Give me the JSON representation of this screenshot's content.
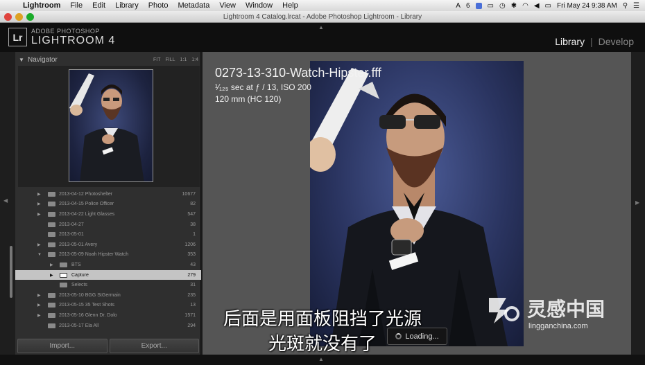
{
  "menubar": {
    "items": [
      "Lightroom",
      "File",
      "Edit",
      "Library",
      "Photo",
      "Metadata",
      "View",
      "Window",
      "Help"
    ],
    "status": {
      "badge": "6",
      "clock": "Fri May 24  9:38 AM"
    }
  },
  "window": {
    "title": "Lightroom 4 Catalog.lrcat - Adobe Photoshop Lightroom - Library"
  },
  "identity": {
    "badge": "Lr",
    "brand_small": "ADOBE PHOTOSHOP",
    "brand_big": "LIGHTROOM 4"
  },
  "modules": {
    "active": "Library",
    "separator": "|",
    "inactive": "Develop"
  },
  "navigator": {
    "title": "Navigator",
    "zoom_options": [
      "FIT",
      "FILL",
      "1:1",
      "1:4"
    ]
  },
  "folders": [
    {
      "name": "2013-04-12 Photoshelter",
      "count": "10677",
      "expand": "right",
      "indent": 0
    },
    {
      "name": "2013-04-15 Police Officer",
      "count": "82",
      "expand": "right",
      "indent": 0
    },
    {
      "name": "2013-04-22 Light Glasses",
      "count": "547",
      "expand": "right",
      "indent": 0
    },
    {
      "name": "2013-04-27",
      "count": "38",
      "expand": "",
      "indent": 0
    },
    {
      "name": "2013-05-01",
      "count": "1",
      "expand": "",
      "indent": 0
    },
    {
      "name": "2013-05-01 Avery",
      "count": "1206",
      "expand": "right",
      "indent": 0
    },
    {
      "name": "2013-05-09 Noah Hipster Watch",
      "count": "353",
      "expand": "down",
      "indent": 0
    },
    {
      "name": "BTS",
      "count": "43",
      "expand": "right",
      "indent": 1
    },
    {
      "name": "Capture",
      "count": "279",
      "expand": "right",
      "indent": 1,
      "selected": true
    },
    {
      "name": "Selects",
      "count": "31",
      "expand": "",
      "indent": 1
    },
    {
      "name": "2013-05-10 BGG StGermain",
      "count": "235",
      "expand": "right",
      "indent": 0
    },
    {
      "name": "2013-05-15 35 Test Shots",
      "count": "13",
      "expand": "right",
      "indent": 0
    },
    {
      "name": "2013-05-16 Glenn Dr. Dolo",
      "count": "1571",
      "expand": "right",
      "indent": 0
    },
    {
      "name": "2013-05-17 Ela All",
      "count": "294",
      "expand": "",
      "indent": 0
    }
  ],
  "buttons": {
    "import": "Import...",
    "export": "Export..."
  },
  "photo_info": {
    "filename": "0273-13-310-Watch-Hipster.fff",
    "exposure": "¹⁄₁₂₅ sec at ƒ / 13, ISO 200",
    "lens": "120 mm (HC 120)"
  },
  "subtitles": {
    "line1": "后面是用面板阻挡了光源",
    "line2": "光斑就没有了"
  },
  "loading": {
    "label": "Loading..."
  },
  "watermark": {
    "text": "灵感中国",
    "url": "lingganchina.com"
  },
  "colors": {
    "selected_row": "#c4c4c4",
    "panel": "#2f2f2f",
    "canvas": "#555555"
  }
}
